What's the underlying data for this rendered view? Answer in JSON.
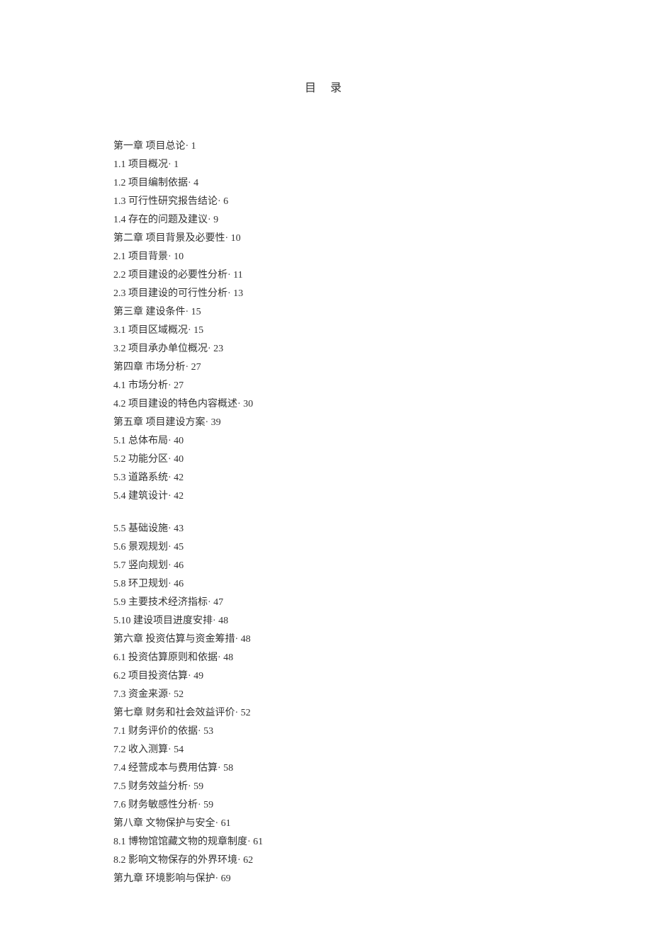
{
  "title": "目 录",
  "entries_block1": [
    "第一章  项目总论· 1",
    "1.1 项目概况· 1",
    "1.2 项目编制依据· 4",
    "1.3 可行性研究报告结论· 6",
    "1.4 存在的问题及建议· 9",
    "第二章  项目背景及必要性· 10",
    "2.1 项目背景· 10",
    "2.2 项目建设的必要性分析· 11",
    "2.3 项目建设的可行性分析· 13",
    "第三章  建设条件· 15",
    "3.1 项目区域概况· 15",
    "3.2 项目承办单位概况· 23",
    "第四章  市场分析· 27",
    "4.1 市场分析· 27",
    "4.2 项目建设的特色内容概述· 30",
    "第五章  项目建设方案· 39",
    "5.1  总体布局· 40",
    "5.2 功能分区· 40",
    "5.3 道路系统· 42",
    "5.4 建筑设计· 42"
  ],
  "entries_block2": [
    "5.5 基础设施· 43",
    "5.6 景观规划· 45",
    "5.7 竖向规划· 46",
    "5.8 环卫规划· 46",
    "5.9 主要技术经济指标· 47",
    "5.10 建设项目进度安排· 48",
    "第六章  投资估算与资金筹措· 48",
    "6.1 投资估算原则和依据· 48",
    "6.2 项目投资估算· 49",
    "7.3 资金来源· 52",
    "第七章  财务和社会效益评价· 52",
    "7.1 财务评价的依据· 53",
    "7.2 收入测算· 54",
    "7.4 经营成本与费用估算· 58",
    "7.5 财务效益分析· 59",
    "7.6 财务敏感性分析· 59",
    "第八章  文物保护与安全· 61",
    "8.1 博物馆馆藏文物的规章制度· 61",
    "8.2 影响文物保存的外界环境· 62",
    "第九章  环境影响与保护· 69"
  ]
}
